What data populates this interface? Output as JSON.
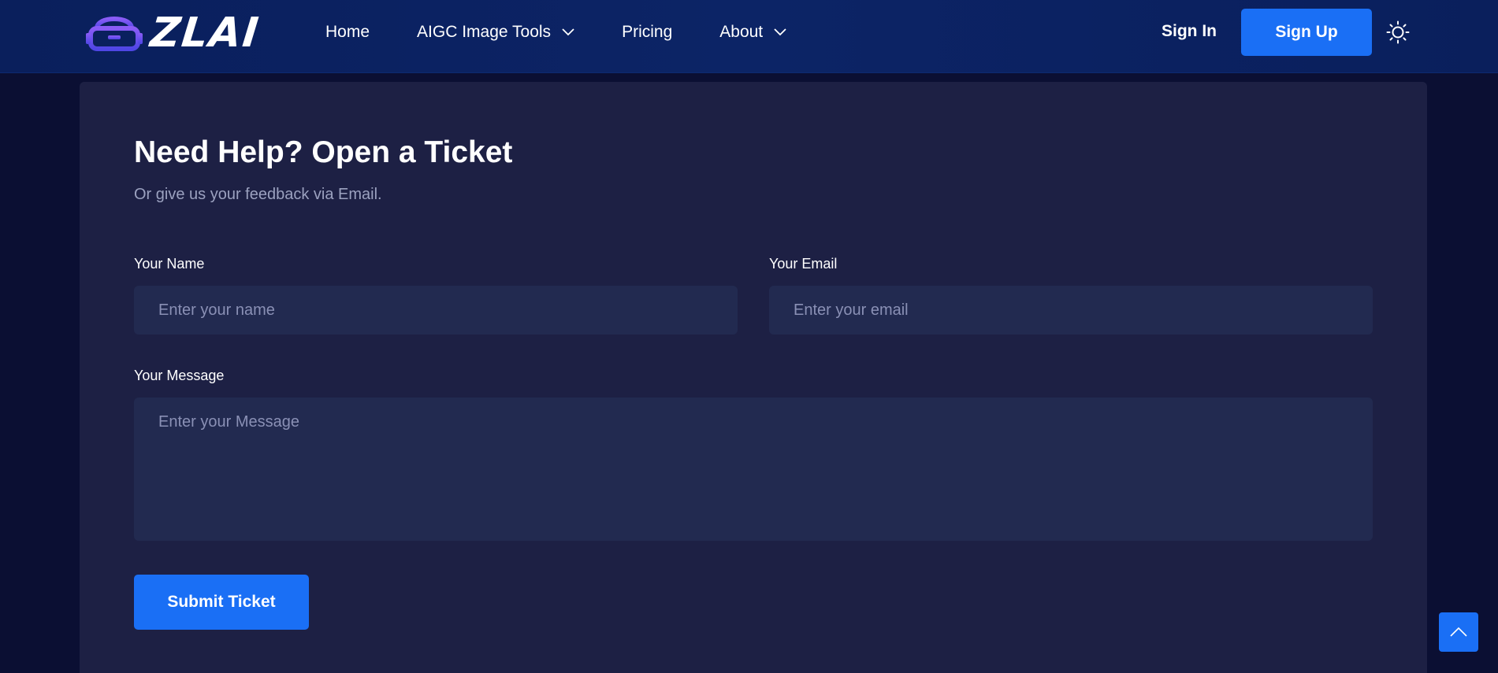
{
  "header": {
    "logo_text": "ZLAI",
    "nav": [
      {
        "label": "Home",
        "has_dropdown": false
      },
      {
        "label": "AIGC Image Tools",
        "has_dropdown": true
      },
      {
        "label": "Pricing",
        "has_dropdown": false
      },
      {
        "label": "About",
        "has_dropdown": true
      }
    ],
    "sign_in": "Sign In",
    "sign_up": "Sign Up",
    "theme_icon": "sun-icon"
  },
  "form": {
    "title": "Need Help? Open a Ticket",
    "subtitle": "Or give us your feedback via Email.",
    "name_label": "Your Name",
    "name_placeholder": "Enter your name",
    "email_label": "Your Email",
    "email_placeholder": "Enter your email",
    "message_label": "Your Message",
    "message_placeholder": "Enter your Message",
    "submit_label": "Submit Ticket"
  },
  "colors": {
    "accent": "#1a6ff5",
    "header_bg": "#0a1f5c",
    "card_bg": "#1d2044",
    "field_bg": "#222a50"
  }
}
